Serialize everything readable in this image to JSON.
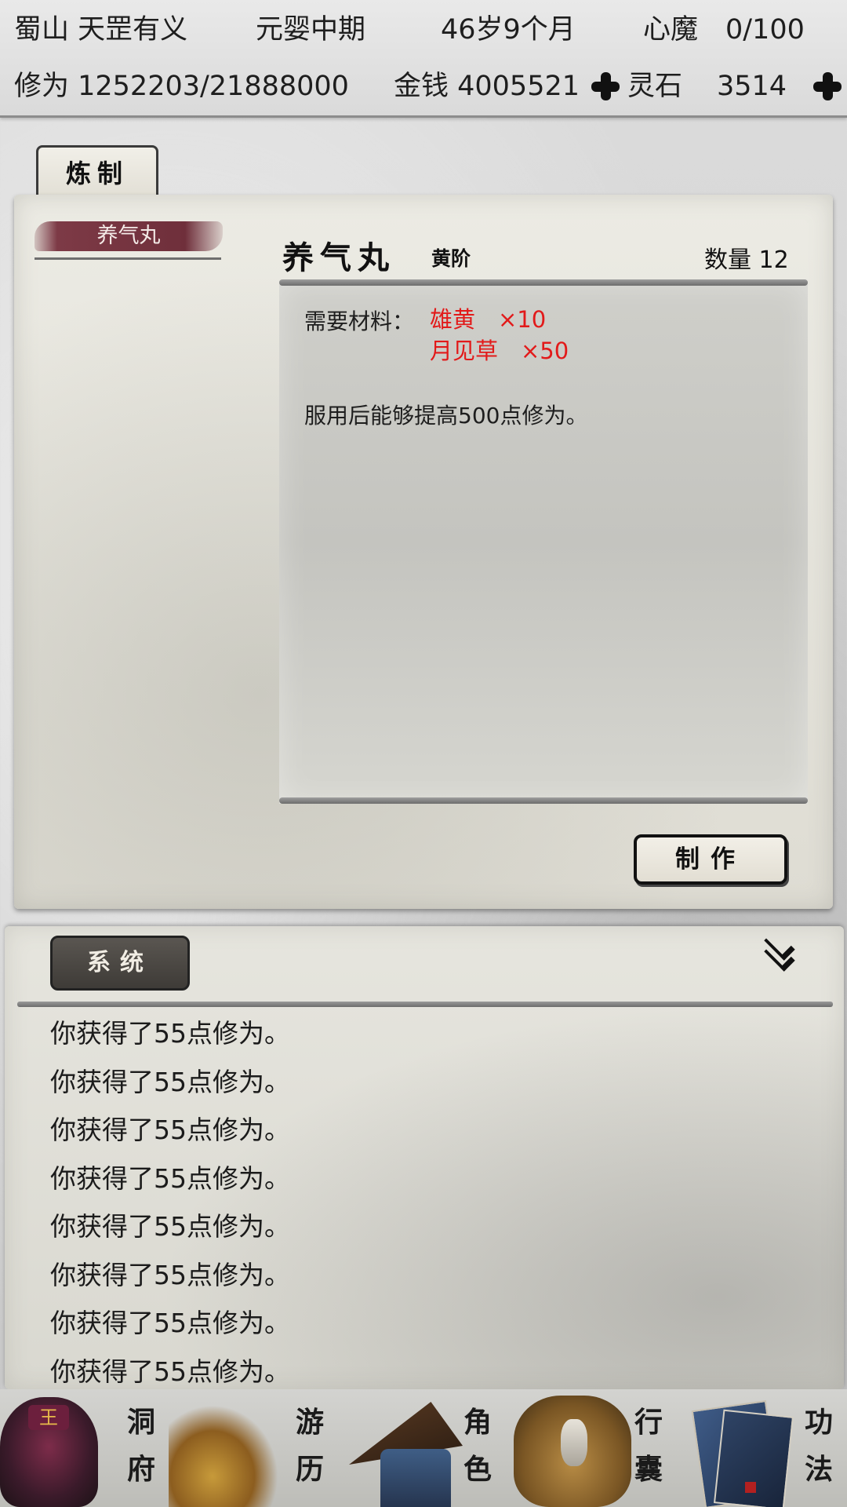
{
  "status": {
    "location": "蜀山 天罡有义",
    "realm": "元婴中期",
    "age": "46岁9个月",
    "heart_demon": "心魔　0/100",
    "cultivation": "修为 1252203/21888000",
    "money": "金钱 4005521",
    "spirit_stone_label": "灵石",
    "spirit_stone_value": "3514"
  },
  "craft": {
    "tab_label": "炼制",
    "recipe_list": [
      "养气丸"
    ],
    "selected": {
      "name": "养气丸",
      "grade": "黄阶",
      "quantity": "数量 12",
      "materials_label": "需要材料：",
      "materials": [
        "雄黄　×10",
        "月见草　×50"
      ],
      "effect": "服用后能够提高500点修为。"
    },
    "make_button": "制作",
    "accent_color": "#7d3a46",
    "material_color": "#e21a1a"
  },
  "log": {
    "tab_label": "系统",
    "entries": [
      "你获得了55点修为。",
      "你获得了55点修为。",
      "你获得了55点修为。",
      "你获得了55点修为。",
      "你获得了55点修为。",
      "你获得了55点修为。",
      "你获得了55点修为。",
      "你获得了55点修为。"
    ]
  },
  "nav": [
    {
      "top": "洞",
      "bottom": "府",
      "icon": "cave-dwelling-icon"
    },
    {
      "top": "游",
      "bottom": "历",
      "icon": "travel-grass-icon"
    },
    {
      "top": "角",
      "bottom": "色",
      "icon": "character-bamboo-hat-icon"
    },
    {
      "top": "行",
      "bottom": "囊",
      "icon": "inventory-bag-icon"
    },
    {
      "top": "功",
      "bottom": "法",
      "icon": "technique-books-icon"
    }
  ]
}
